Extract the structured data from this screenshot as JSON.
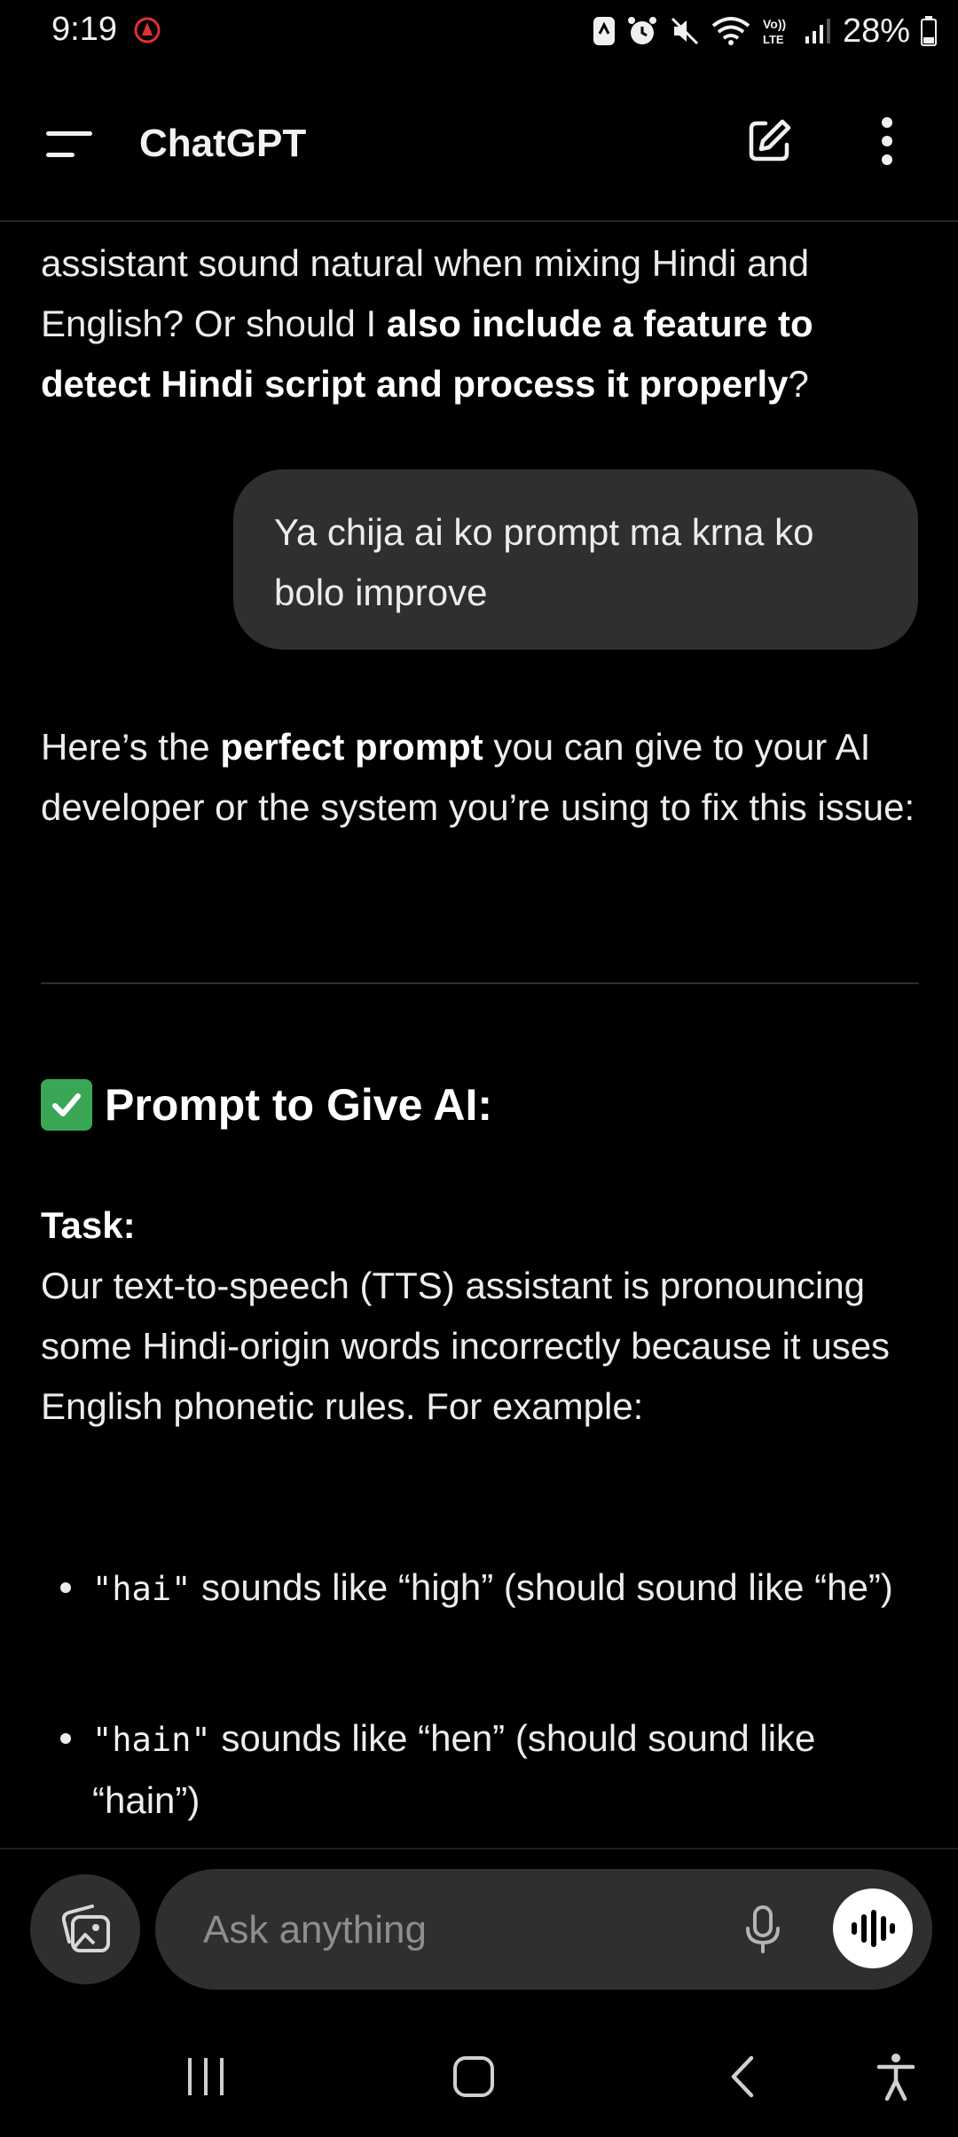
{
  "status_bar": {
    "time": "9:19",
    "battery": "28%"
  },
  "header": {
    "title": "ChatGPT"
  },
  "messages": {
    "assistant_intro": {
      "p1": "assistant sound natural when mixing Hindi and English? Or should I ",
      "p1_bold": "also include a feature to detect Hindi script and process it properly",
      "p1_end": "?"
    },
    "user_message": "Ya chija ai ko prompt ma krna ko bolo improve",
    "reply": {
      "p_start": "Here’s the ",
      "p_bold": "perfect prompt",
      "p_end": " you can give to your AI developer or the system you’re using to fix this issue:",
      "heading": "Prompt to Give AI:",
      "task_label": "Task:",
      "task_body": "Our text-to-speech (TTS) assistant is pronouncing some Hindi-origin words incorrectly because it uses English phonetic rules. For example:",
      "bullets": [
        {
          "code": "\"hai\"",
          "text": " sounds like “high” (should sound like “he”)"
        },
        {
          "code": "\"hain\"",
          "text": " sounds like “hen” (should sound like “hain”)"
        }
      ]
    }
  },
  "composer": {
    "placeholder": "Ask anything"
  },
  "icons": {
    "menu": "menu-icon",
    "new_chat": "edit-icon",
    "more": "more-vertical-icon",
    "attach": "image-attach-icon",
    "mic": "microphone-icon",
    "voice": "voice-waveform-icon",
    "check": "check-mark-icon"
  },
  "colors": {
    "background": "#000000",
    "bubble": "#2f2f2f",
    "check": "#3aa757"
  }
}
